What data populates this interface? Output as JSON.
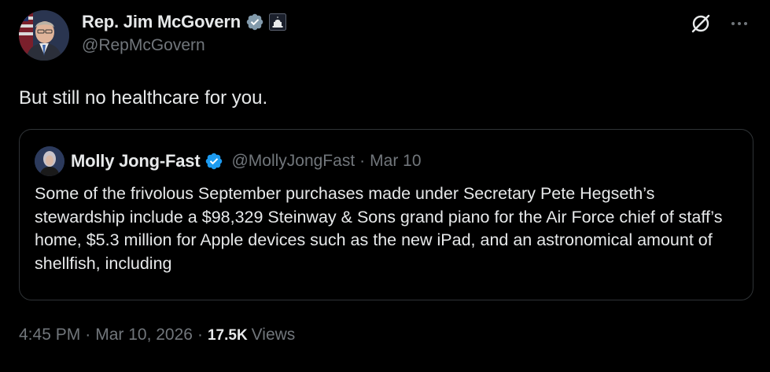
{
  "author": {
    "name": "Rep. Jim McGovern",
    "handle": "@RepMcGovern",
    "verified_icon": "verified-badge-gray-icon",
    "affiliation_icon": "government-capitol-icon"
  },
  "tweet": {
    "text": "But still no healthcare for you."
  },
  "quote": {
    "name": "Molly Jong-Fast",
    "handle": "@MollyJongFast",
    "separator": "·",
    "date": "Mar 10",
    "verified_icon": "verified-badge-blue-icon",
    "text": "Some of the frivolous September purchases made under Secretary Pete Hegseth’s stewardship include a $98,329 Steinway & Sons grand piano for the Air Force chief of staff’s home, $5.3 million for Apple devices such as the new iPad, and an astronomical amount of shellfish, including"
  },
  "footer": {
    "time": "4:45 PM",
    "separator": "·",
    "date": "Mar 10, 2026",
    "views_count": "17.5K",
    "views_label": "Views"
  },
  "icons": {
    "grok": "grok-icon",
    "more": "more-icon"
  },
  "colors": {
    "background": "#000000",
    "text_primary": "#e7e9ea",
    "text_secondary": "#71767b",
    "border": "#2f3336",
    "verified_blue": "#1d9bf0",
    "verified_gray": "#829aab"
  }
}
